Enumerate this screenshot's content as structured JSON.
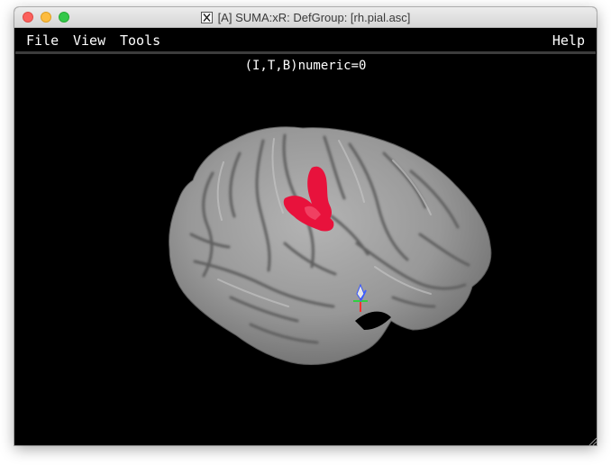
{
  "window": {
    "title": "[A] SUMA:xR: DefGroup: [rh.pial.asc]"
  },
  "menubar": {
    "file": "File",
    "view": "View",
    "tools": "Tools",
    "help": "Help"
  },
  "viewer": {
    "status": "(I,T,B)numeric=0"
  },
  "colors": {
    "background": "#000000",
    "surface": "#9a9a9a",
    "activation": "#e8123c"
  }
}
